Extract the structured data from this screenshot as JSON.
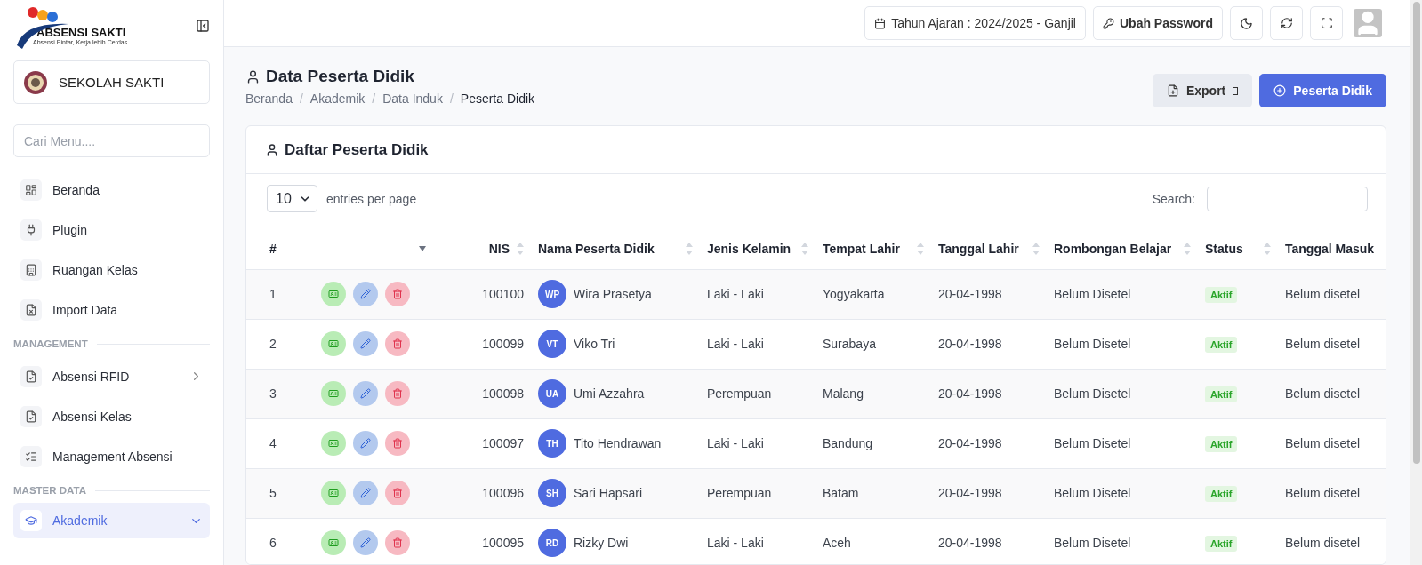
{
  "brand": {
    "name": "ABSENSI SAKTI",
    "tagline": "Absensi Pintar, Kerja lebih Cerdas"
  },
  "school": {
    "name": "SEKOLAH SAKTI"
  },
  "menu_search": {
    "placeholder": "Cari Menu...."
  },
  "sidebar": [
    {
      "items": [
        {
          "label": "Beranda",
          "kind": "link",
          "selected": false
        },
        {
          "label": "Plugin",
          "kind": "link",
          "selected": false
        },
        {
          "label": "Ruangan Kelas",
          "kind": "link",
          "selected": false
        },
        {
          "label": "Import Data",
          "kind": "link",
          "selected": false
        }
      ]
    },
    {
      "heading": "MANAGEMENT",
      "items": [
        {
          "label": "Absensi RFID",
          "kind": "group",
          "expanded": false,
          "selected": false
        },
        {
          "label": "Absensi Kelas",
          "kind": "link",
          "selected": false
        },
        {
          "label": "Management Absensi",
          "kind": "link",
          "selected": false
        }
      ]
    },
    {
      "heading": "MASTER DATA",
      "items": [
        {
          "label": "Akademik",
          "kind": "group",
          "expanded": true,
          "selected": true
        }
      ]
    }
  ],
  "topbar": {
    "school_year": "Tahun Ajaran : 2024/2025 - Ganjil",
    "password_button": "Ubah Password"
  },
  "page": {
    "title": "Data Peserta Didik",
    "breadcrumb": [
      "Beranda",
      "Akademik",
      "Data Induk",
      "Peserta Didik"
    ],
    "breadcrumb_separator": "/",
    "export_button": "Export",
    "add_button": "Peserta Didik"
  },
  "card": {
    "title": "Daftar Peserta Didik",
    "page_size": "10",
    "page_size_label": "entries per page",
    "search_label": "Search:"
  },
  "table": {
    "columns": [
      {
        "label": "#",
        "sortable": false
      },
      {
        "sortable": false
      },
      {
        "label": "NIS",
        "sortable": true
      },
      {
        "label": "Nama Peserta Didik",
        "sortable": true
      },
      {
        "label": "Jenis Kelamin",
        "sortable": true
      },
      {
        "label": "Tempat Lahir",
        "sortable": true
      },
      {
        "label": "Tanggal Lahir",
        "sortable": true
      },
      {
        "label": "Rombongan Belajar",
        "sortable": true
      },
      {
        "label": "Status",
        "sortable": true
      },
      {
        "label": "Tanggal Masuk"
      }
    ],
    "rows": [
      {
        "no": "1",
        "nis": "100100",
        "initials": "WP",
        "name": "Wira Prasetya",
        "gender": "Laki - Laki",
        "birthplace": "Yogyakarta",
        "birthdate": "20-04-1998",
        "group": "Belum Disetel",
        "status": "Aktif",
        "entry_date": "Belum disetel"
      },
      {
        "no": "2",
        "nis": "100099",
        "initials": "VT",
        "name": "Viko Tri",
        "gender": "Laki - Laki",
        "birthplace": "Surabaya",
        "birthdate": "20-04-1998",
        "group": "Belum Disetel",
        "status": "Aktif",
        "entry_date": "Belum disetel"
      },
      {
        "no": "3",
        "nis": "100098",
        "initials": "UA",
        "name": "Umi Azzahra",
        "gender": "Perempuan",
        "birthplace": "Malang",
        "birthdate": "20-04-1998",
        "group": "Belum Disetel",
        "status": "Aktif",
        "entry_date": "Belum disetel"
      },
      {
        "no": "4",
        "nis": "100097",
        "initials": "TH",
        "name": "Tito Hendrawan",
        "gender": "Laki - Laki",
        "birthplace": "Bandung",
        "birthdate": "20-04-1998",
        "group": "Belum Disetel",
        "status": "Aktif",
        "entry_date": "Belum disetel"
      },
      {
        "no": "5",
        "nis": "100096",
        "initials": "SH",
        "name": "Sari Hapsari",
        "gender": "Perempuan",
        "birthplace": "Batam",
        "birthdate": "20-04-1998",
        "group": "Belum Disetel",
        "status": "Aktif",
        "entry_date": "Belum disetel"
      },
      {
        "no": "6",
        "nis": "100095",
        "initials": "RD",
        "name": "Rizky Dwi",
        "gender": "Laki - Laki",
        "birthplace": "Aceh",
        "birthdate": "20-04-1998",
        "group": "Belum Disetel",
        "status": "Aktif",
        "entry_date": "Belum disetel"
      }
    ]
  }
}
